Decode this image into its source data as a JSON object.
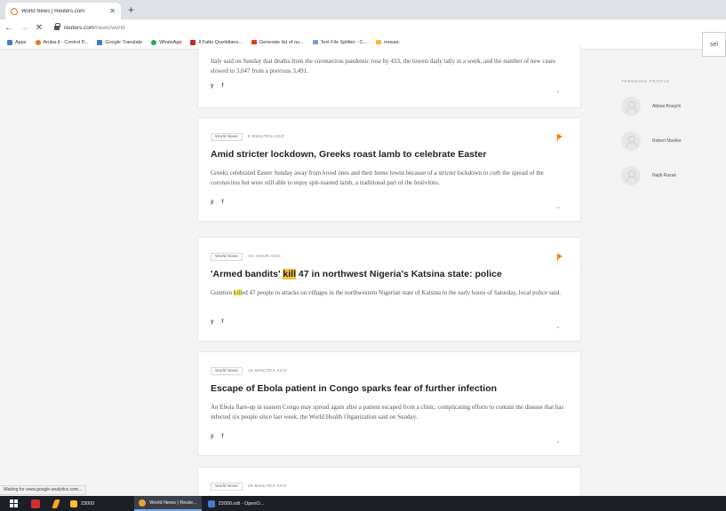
{
  "browser": {
    "tab_title": "World News | Reuters.com",
    "tab_close": "✕",
    "new_tab": "+",
    "back": "←",
    "forward": "→",
    "reload": "✕",
    "url_host": "reuters.com",
    "url_path": "/news/world",
    "ext_label": "sel",
    "status": "Waiting for www.google-analytics.com..."
  },
  "bookmarks": [
    {
      "label": "Apps",
      "color": "#4a7bd1"
    },
    {
      "label": "Aruba.it - Control P...",
      "color": "#e87722"
    },
    {
      "label": "Google Translate",
      "color": "#3b7bd8"
    },
    {
      "label": "WhatsApp",
      "color": "#2aa84a"
    },
    {
      "label": "Il Fatto Quotidiano...",
      "color": "#c62828"
    },
    {
      "label": "Generate list of nu...",
      "color": "#d84315"
    },
    {
      "label": "Text File Splitter - C...",
      "color": "#7aa0cf"
    },
    {
      "label": "mosaic",
      "color": "#f1c232"
    }
  ],
  "cards": [
    {
      "body": "Italy said on Sunday that deaths from the coronavirus pandemic rose by 433, the lowest daily tally in a week, and the number of new cases slowed to 3,047 from a previous 3,491."
    },
    {
      "category": "World News",
      "time": "5 MINUTES AGO",
      "title": "Amid stricter lockdown, Greeks roast lamb to celebrate Easter",
      "body": "Greeks celebrated Easter Sunday away from loved ones and their home towns because of a stricter lockdown to curb the spread of the coronavirus but were still able to enjoy spit-roasted lamb, a traditional part of the festivities."
    },
    {
      "category": "World News",
      "time": "AN HOUR AGO",
      "title_pre": "'Armed bandits' ",
      "title_hl": "kill",
      "title_post": " 47 in northwest Nigeria's Katsina state: police",
      "body_pre": "Gunmen ",
      "body_hl": "kill",
      "body_post": "ed 47 people in attacks on villages in the northwestern Nigerian state of Katsina in the early hours of Saturday, local police said."
    },
    {
      "category": "World News",
      "time": "19 MINUTES AGO",
      "title": "Escape of Ebola patient in Congo sparks fear of further infection",
      "body": "An Ebola flare-up in eastern Congo may spread again after a patient escaped from a clinic, complicating efforts to contain the disease that has infected six people since last week, the World Health Organization said on Sunday."
    },
    {
      "category": "World News",
      "time": "25 MINUTES AGO"
    }
  ],
  "social": {
    "twitter": "y",
    "facebook": "f",
    "chevron": "⌄"
  },
  "trending": {
    "title": "Trending People",
    "people": [
      "Abbas Araqchi",
      "Robert Mueller",
      "Najib Razak"
    ]
  },
  "taskbar": {
    "apps": [
      {
        "label": "23000",
        "color": "#f1c232"
      },
      {
        "label": "World News | Reute...",
        "color": "#e8a33d"
      },
      {
        "label": "23000.odt - OpenO...",
        "color": "#4a7bd1"
      }
    ]
  }
}
